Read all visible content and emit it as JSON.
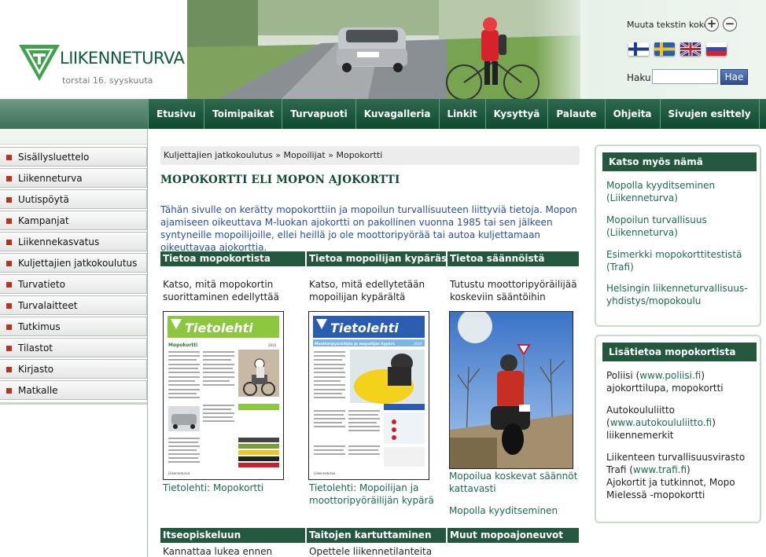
{
  "header": {
    "logo_text": "LIIKENNETURVA",
    "date": "torstai 16. syyskuuta",
    "font_size_label": "Muuta tekstin kokoa",
    "increase_symbol": "+",
    "decrease_symbol": "−",
    "search_label": "Haku",
    "search_value": "",
    "search_button": "Hae",
    "languages": [
      "fi",
      "sv",
      "en",
      "ru"
    ]
  },
  "nav": {
    "items": [
      "Etusivu",
      "Toimipaikat",
      "Turvapuoti",
      "Kuvagalleria",
      "Linkit",
      "Kysyttyä",
      "Palaute",
      "Ohjeita",
      "Sivujen esittely"
    ]
  },
  "sidebar": {
    "items": [
      "Sisällysluettelo",
      "Liikenneturva",
      "Uutispöytä",
      "Kampanjat",
      "Liikennekasvatus",
      "Kuljettajien jatkokoulutus",
      "Turvatieto",
      "Turvalaitteet",
      "Tutkimus",
      "Tilastot",
      "Kirjasto",
      "Matkalle"
    ]
  },
  "breadcrumb": {
    "items": [
      "Kuljettajien jatkokoulutus",
      "Mopoilijat",
      "Mopokortti"
    ],
    "separator": "»"
  },
  "main": {
    "title": "MOPOKORTTI ELI MOPON AJOKORTTI",
    "intro": "Tähän sivulle on kerätty mopokorttiin ja mopoilun turvallisuuteen liittyviä tietoja. Mopon ajamiseen oikeuttava M-luokan ajokortti on pakollinen vuonna 1985 tai sen jälkeen syntyneille mopoilijoille, ellei heillä jo ole moottoripyörää tai autoa kuljettamaan oikeuttavaa ajokorttia.",
    "columns": [
      {
        "header": "Tietoa mopokortista",
        "text": "Katso, mitä mopokortin suorittaminen edellyttää",
        "doc_title": "Tietolehti",
        "doc_subtitle": "Mopokortti",
        "doc_year": "2010",
        "doc_footer": "Liikenneturva",
        "links": [
          "Tietolehti: Mopokortti"
        ]
      },
      {
        "header": "Tietoa mopoilijan kypärästä",
        "text": "Katso, mitä edellytetään mopoilijan kypärältä",
        "doc_title": "Tietolehti",
        "doc_subtitle": "Moottoripyöräilijän ja mopoilijan kypärä",
        "doc_year": "2010",
        "doc_footer": "Liikenneturva",
        "links": [
          "Tietolehti: Mopoilijan ja moottoripyöräilijän kypärä"
        ]
      },
      {
        "header": "Tietoa säännöistä",
        "text": "Tutustu moottoripyöräilijää koskeviin sääntöihin",
        "links": [
          "Mopoilua koskevat säännöt kattavasti",
          "Mopolla kyyditseminen"
        ]
      }
    ],
    "bottom_columns": [
      {
        "header": "Itseopiskeluun",
        "text": "Kannattaa lukea ennen"
      },
      {
        "header": "Taitojen kartuttaminen",
        "text": "Opettele liikennetilanteita"
      },
      {
        "header": "Muut mopoajoneuvot",
        "text": ""
      }
    ]
  },
  "right": {
    "box1": {
      "title": "Katso myös nämä",
      "links": [
        "Mopolla kyyditseminen (Liikenneturva)",
        "Mopoilun turvallisuus (Liikenneturva)",
        "Esimerkki mopokorttitestistä (Trafi)",
        "Helsingin liikenneturvallisuus-yhdistys/mopokoulu"
      ]
    },
    "box2": {
      "title": "Lisätietoa mopokortista",
      "entries": [
        {
          "name": "Poliisi",
          "url": "www.poliisi.fi",
          "desc": "ajokorttilupa, mopokortti"
        },
        {
          "name": "Autokoululiitto",
          "url": "www.autokoululiitto.fi",
          "desc": "liikennemerkit"
        },
        {
          "name": "Liikenteen turvallisuusvirasto Trafi",
          "url": "www.trafi.fi",
          "desc": "Ajokortit ja tutkinnot, Mopo Mielessä -mopokortti"
        }
      ]
    }
  },
  "colors": {
    "brand_green": "#0f4a30",
    "header_green": "#23573e",
    "link_green": "#1c6b4a",
    "intro_blue": "#2a4f9c",
    "bullet_red": "#b8321e",
    "doc1_accent": "#8dc63f",
    "doc2_accent": "#2a5db0"
  }
}
